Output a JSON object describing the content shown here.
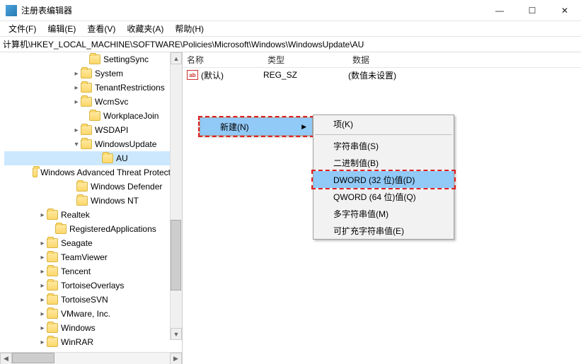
{
  "window": {
    "title": "注册表编辑器",
    "min": "—",
    "max": "☐",
    "close": "✕"
  },
  "menubar": {
    "file": "文件(F)",
    "edit": "编辑(E)",
    "view": "查看(V)",
    "favorites": "收藏夹(A)",
    "help": "帮助(H)"
  },
  "address": "计算机\\HKEY_LOCAL_MACHINE\\SOFTWARE\\Policies\\Microsoft\\Windows\\WindowsUpdate\\AU",
  "tree": [
    {
      "indent": 108,
      "exp": "",
      "label": "SettingSync"
    },
    {
      "indent": 96,
      "exp": "›",
      "label": "System"
    },
    {
      "indent": 96,
      "exp": "›",
      "label": "TenantRestrictions"
    },
    {
      "indent": 96,
      "exp": "›",
      "label": "WcmSvc"
    },
    {
      "indent": 108,
      "exp": "",
      "label": "WorkplaceJoin"
    },
    {
      "indent": 96,
      "exp": "›",
      "label": "WSDAPI"
    },
    {
      "indent": 96,
      "exp": "⌄",
      "label": "WindowsUpdate"
    },
    {
      "indent": 126,
      "exp": "",
      "label": "AU",
      "selected": true
    },
    {
      "indent": 90,
      "exp": "",
      "label": "Windows Advanced Threat Protection"
    },
    {
      "indent": 90,
      "exp": "",
      "label": "Windows Defender"
    },
    {
      "indent": 90,
      "exp": "",
      "label": "Windows NT"
    },
    {
      "indent": 48,
      "exp": "›",
      "label": "Realtek"
    },
    {
      "indent": 60,
      "exp": "",
      "label": "RegisteredApplications"
    },
    {
      "indent": 48,
      "exp": "›",
      "label": "Seagate"
    },
    {
      "indent": 48,
      "exp": "›",
      "label": "TeamViewer"
    },
    {
      "indent": 48,
      "exp": "›",
      "label": "Tencent"
    },
    {
      "indent": 48,
      "exp": "›",
      "label": "TortoiseOverlays"
    },
    {
      "indent": 48,
      "exp": "›",
      "label": "TortoiseSVN"
    },
    {
      "indent": 48,
      "exp": "›",
      "label": "VMware, Inc."
    },
    {
      "indent": 48,
      "exp": "›",
      "label": "Windows"
    },
    {
      "indent": 48,
      "exp": "›",
      "label": "WinRAR"
    }
  ],
  "list": {
    "headers": {
      "name": "名称",
      "type": "类型",
      "data": "数据"
    },
    "rows": [
      {
        "name": "(默认)",
        "type": "REG_SZ",
        "data": "(数值未设置)"
      }
    ]
  },
  "contextMenu1": {
    "new": "新建(N)"
  },
  "contextMenu2": {
    "key": "项(K)",
    "string": "字符串值(S)",
    "binary": "二进制值(B)",
    "dword": "DWORD (32 位)值(D)",
    "qword": "QWORD (64 位)值(Q)",
    "multistring": "多字符串值(M)",
    "expandstring": "可扩充字符串值(E)"
  }
}
